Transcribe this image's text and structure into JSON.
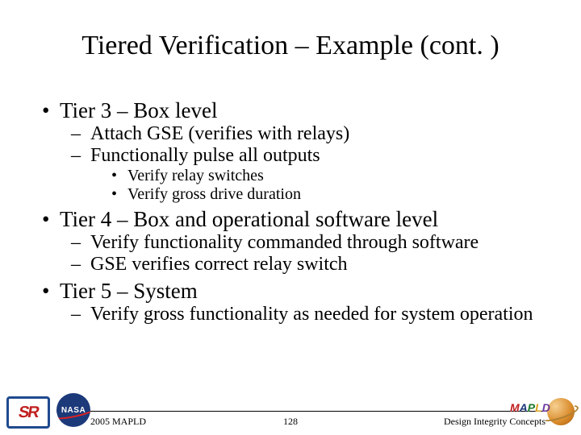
{
  "title": "Tiered Verification – Example (cont. )",
  "bullets": {
    "tier3": "Tier 3 – Box level",
    "tier3_a": "Attach GSE (verifies with relays)",
    "tier3_b": "Functionally pulse all outputs",
    "tier3_b_i": "Verify relay switches",
    "tier3_b_ii": "Verify gross drive duration",
    "tier4": "Tier 4 – Box and operational software level",
    "tier4_a": "Verify functionality commanded through software",
    "tier4_b": "GSE verifies correct relay switch",
    "tier5": "Tier 5 – System",
    "tier5_a": "Verify gross functionality as needed for system operation"
  },
  "footer": {
    "left": "2005 MAPLD",
    "center": "128",
    "right": "Design Integrity Concepts"
  },
  "logos": {
    "sr": "SR",
    "nasa": "NASA",
    "mapld": "MAPLD"
  }
}
